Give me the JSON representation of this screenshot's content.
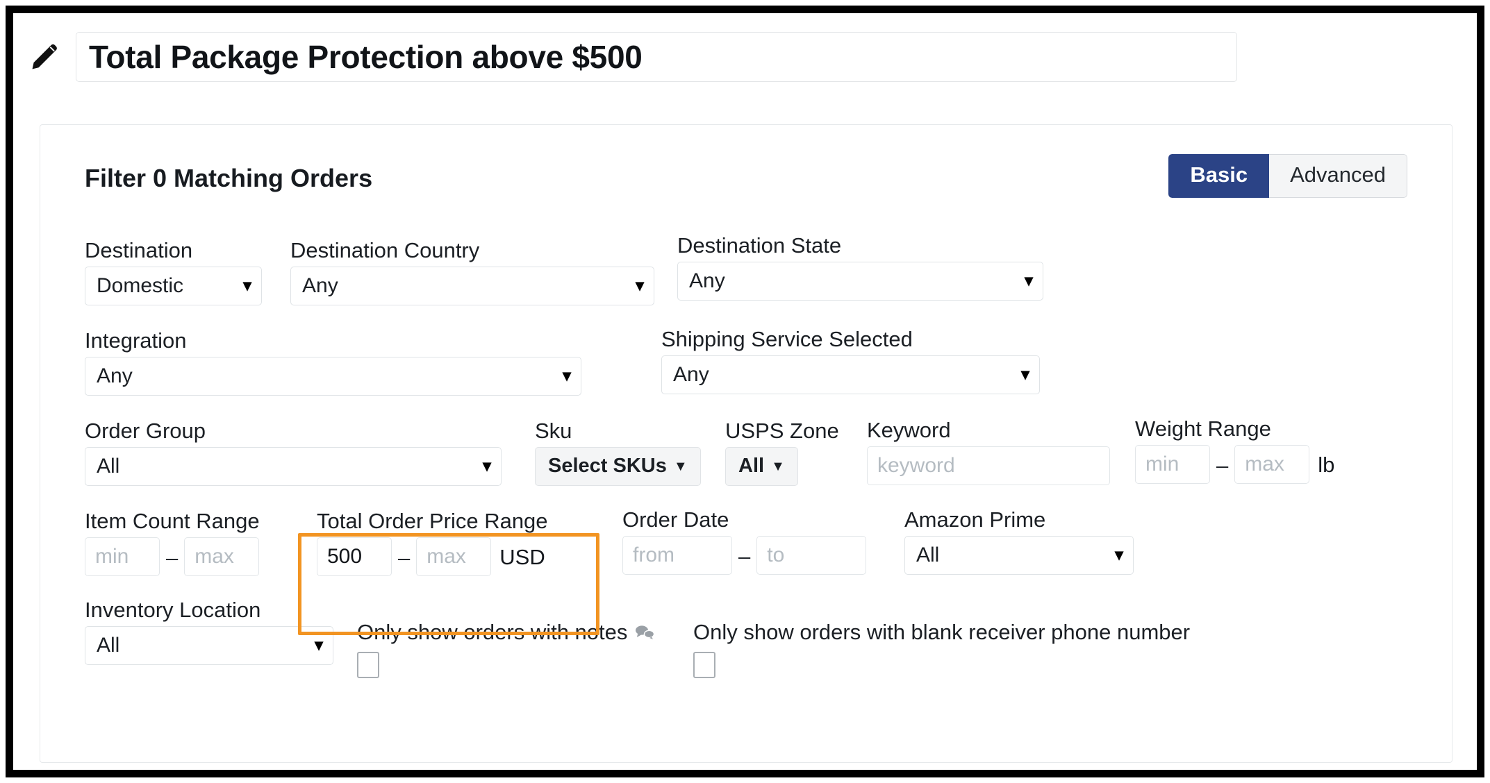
{
  "header": {
    "edit_icon": "pencil-icon",
    "title": "Total Package Protection above $500"
  },
  "filter_card": {
    "heading": "Filter 0 Matching Orders",
    "mode_toggle": {
      "active": "Basic",
      "inactive": "Advanced",
      "active_color": "#2b4386"
    },
    "fields": {
      "destination": {
        "label": "Destination",
        "value": "Domestic"
      },
      "destination_country": {
        "label": "Destination Country",
        "value": "Any"
      },
      "destination_state": {
        "label": "Destination State",
        "value": "Any"
      },
      "integration": {
        "label": "Integration",
        "value": "Any"
      },
      "shipping_service_selected": {
        "label": "Shipping Service Selected",
        "value": "Any"
      },
      "order_group": {
        "label": "Order Group",
        "value": "All"
      },
      "sku": {
        "label": "Sku",
        "button": "Select SKUs"
      },
      "usps_zone": {
        "label": "USPS Zone",
        "button": "All"
      },
      "keyword": {
        "label": "Keyword",
        "placeholder": "keyword",
        "value": ""
      },
      "weight_range": {
        "label": "Weight Range",
        "min_placeholder": "min",
        "max_placeholder": "max",
        "min_value": "",
        "max_value": "",
        "separator": "–",
        "unit": "lb"
      },
      "item_count_range": {
        "label": "Item Count Range",
        "min_placeholder": "min",
        "max_placeholder": "max",
        "min_value": "",
        "max_value": "",
        "separator": "–"
      },
      "total_order_price_range": {
        "label": "Total Order Price Range",
        "min_placeholder": "min",
        "max_placeholder": "max",
        "min_value": "500",
        "max_value": "",
        "separator": "–",
        "unit": "USD",
        "highlighted": true,
        "highlight_color": "#f29422"
      },
      "order_date": {
        "label": "Order Date",
        "from_placeholder": "from",
        "to_placeholder": "to",
        "from_value": "",
        "to_value": "",
        "separator": "–"
      },
      "amazon_prime": {
        "label": "Amazon Prime",
        "value": "All"
      },
      "inventory_location": {
        "label": "Inventory Location",
        "value": "All"
      },
      "only_notes": {
        "label": "Only show orders with notes",
        "icon": "comments-icon",
        "checked": false
      },
      "only_blank_phone": {
        "label": "Only show orders with blank receiver phone number",
        "checked": false
      }
    }
  }
}
